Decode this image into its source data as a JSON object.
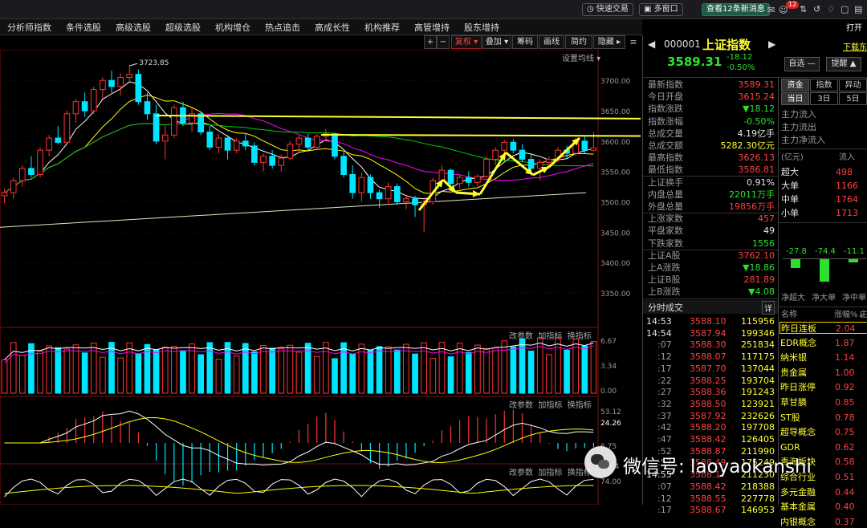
{
  "topbar": {
    "quick_trade": "快速交易",
    "multi_window": "多窗口",
    "news": "查看12条新消息",
    "badge": "12",
    "right_text": "打开"
  },
  "menu": [
    "分析师指数",
    "条件选股",
    "高级选股",
    "超级选股",
    "机构增仓",
    "热点追击",
    "高成长性",
    "机构推荐",
    "高管增持",
    "股东增持"
  ],
  "toolbar": {
    "plus": "+",
    "minus": "−",
    "left": "←",
    "right": "→",
    "restore": "复权",
    "overlay": "叠加",
    "chip": "筹码",
    "draw": "画线",
    "simple": "简约",
    "hide": "隐藏"
  },
  "chart_labels": {
    "ma_settings": "设置均线",
    "high_label": "3723.85",
    "ind_settings": "改参数",
    "ind_add": "加指标",
    "ind_switch": "换指标"
  },
  "price_axis": [
    "3700.00",
    "3650.00",
    "3600.00",
    "3550.00",
    "3500.00",
    "3450.00",
    "3400.00",
    "3350.00"
  ],
  "vol_axis": [
    "6.67",
    "3.34",
    "0.00"
  ],
  "macd_axis": [
    "53.12",
    "24.26",
    "6.75",
    "-21.4"
  ],
  "kdj_axis": [
    "74.00"
  ],
  "colors": {
    "up": "#ff3333",
    "down": "#00e5ff",
    "ma5": "#ffffff",
    "ma10": "#ffff00",
    "ma20": "#ff00ff",
    "ma60": "#00d000",
    "arrow": "#ffff33"
  },
  "chart_data": {
    "type": "candlestick",
    "candles": [
      {
        "o": 3510,
        "h": 3522,
        "l": 3498,
        "c": 3515
      },
      {
        "o": 3515,
        "h": 3540,
        "l": 3505,
        "c": 3535
      },
      {
        "o": 3535,
        "h": 3560,
        "l": 3525,
        "c": 3555
      },
      {
        "o": 3555,
        "h": 3575,
        "l": 3540,
        "c": 3545
      },
      {
        "o": 3545,
        "h": 3590,
        "l": 3540,
        "c": 3585
      },
      {
        "o": 3585,
        "h": 3610,
        "l": 3575,
        "c": 3605
      },
      {
        "o": 3605,
        "h": 3625,
        "l": 3595,
        "c": 3598
      },
      {
        "o": 3598,
        "h": 3650,
        "l": 3595,
        "c": 3645
      },
      {
        "o": 3645,
        "h": 3670,
        "l": 3630,
        "c": 3665
      },
      {
        "o": 3665,
        "h": 3680,
        "l": 3640,
        "c": 3650
      },
      {
        "o": 3650,
        "h": 3690,
        "l": 3645,
        "c": 3685
      },
      {
        "o": 3685,
        "h": 3705,
        "l": 3670,
        "c": 3700
      },
      {
        "o": 3700,
        "h": 3716,
        "l": 3680,
        "c": 3690
      },
      {
        "o": 3690,
        "h": 3712,
        "l": 3675,
        "c": 3705
      },
      {
        "o": 3705,
        "h": 3724,
        "l": 3695,
        "c": 3710
      },
      {
        "o": 3710,
        "h": 3718,
        "l": 3660,
        "c": 3665
      },
      {
        "o": 3665,
        "h": 3680,
        "l": 3635,
        "c": 3645
      },
      {
        "o": 3645,
        "h": 3660,
        "l": 3595,
        "c": 3600
      },
      {
        "o": 3600,
        "h": 3625,
        "l": 3570,
        "c": 3610
      },
      {
        "o": 3610,
        "h": 3660,
        "l": 3605,
        "c": 3655
      },
      {
        "o": 3655,
        "h": 3665,
        "l": 3625,
        "c": 3630
      },
      {
        "o": 3630,
        "h": 3655,
        "l": 3615,
        "c": 3645
      },
      {
        "o": 3645,
        "h": 3648,
        "l": 3610,
        "c": 3615
      },
      {
        "o": 3615,
        "h": 3625,
        "l": 3585,
        "c": 3590
      },
      {
        "o": 3590,
        "h": 3612,
        "l": 3580,
        "c": 3605
      },
      {
        "o": 3605,
        "h": 3610,
        "l": 3570,
        "c": 3585
      },
      {
        "o": 3585,
        "h": 3605,
        "l": 3580,
        "c": 3600
      },
      {
        "o": 3600,
        "h": 3612,
        "l": 3585,
        "c": 3592
      },
      {
        "o": 3592,
        "h": 3598,
        "l": 3560,
        "c": 3565
      },
      {
        "o": 3565,
        "h": 3580,
        "l": 3550,
        "c": 3575
      },
      {
        "o": 3575,
        "h": 3585,
        "l": 3555,
        "c": 3560
      },
      {
        "o": 3560,
        "h": 3578,
        "l": 3550,
        "c": 3572
      },
      {
        "o": 3572,
        "h": 3600,
        "l": 3568,
        "c": 3595
      },
      {
        "o": 3595,
        "h": 3610,
        "l": 3580,
        "c": 3605
      },
      {
        "o": 3605,
        "h": 3612,
        "l": 3585,
        "c": 3590
      },
      {
        "o": 3590,
        "h": 3612,
        "l": 3588,
        "c": 3608
      },
      {
        "o": 3608,
        "h": 3620,
        "l": 3600,
        "c": 3612
      },
      {
        "o": 3612,
        "h": 3614,
        "l": 3570,
        "c": 3575
      },
      {
        "o": 3575,
        "h": 3582,
        "l": 3540,
        "c": 3545
      },
      {
        "o": 3545,
        "h": 3560,
        "l": 3505,
        "c": 3515
      },
      {
        "o": 3515,
        "h": 3548,
        "l": 3500,
        "c": 3540
      },
      {
        "o": 3540,
        "h": 3545,
        "l": 3505,
        "c": 3515
      },
      {
        "o": 3515,
        "h": 3520,
        "l": 3490,
        "c": 3505
      },
      {
        "o": 3505,
        "h": 3532,
        "l": 3495,
        "c": 3525
      },
      {
        "o": 3525,
        "h": 3530,
        "l": 3495,
        "c": 3500
      },
      {
        "o": 3500,
        "h": 3512,
        "l": 3488,
        "c": 3505
      },
      {
        "o": 3505,
        "h": 3510,
        "l": 3475,
        "c": 3495
      },
      {
        "o": 3495,
        "h": 3505,
        "l": 3450,
        "c": 3500
      },
      {
        "o": 3500,
        "h": 3540,
        "l": 3495,
        "c": 3535
      },
      {
        "o": 3535,
        "h": 3560,
        "l": 3530,
        "c": 3552
      },
      {
        "o": 3552,
        "h": 3555,
        "l": 3525,
        "c": 3530
      },
      {
        "o": 3530,
        "h": 3545,
        "l": 3522,
        "c": 3540
      },
      {
        "o": 3540,
        "h": 3550,
        "l": 3525,
        "c": 3532
      },
      {
        "o": 3532,
        "h": 3545,
        "l": 3525,
        "c": 3542
      },
      {
        "o": 3542,
        "h": 3575,
        "l": 3538,
        "c": 3570
      },
      {
        "o": 3570,
        "h": 3590,
        "l": 3560,
        "c": 3585
      },
      {
        "o": 3585,
        "h": 3602,
        "l": 3578,
        "c": 3598
      },
      {
        "o": 3598,
        "h": 3603,
        "l": 3580,
        "c": 3585
      },
      {
        "o": 3585,
        "h": 3595,
        "l": 3565,
        "c": 3570
      },
      {
        "o": 3570,
        "h": 3580,
        "l": 3548,
        "c": 3555
      },
      {
        "o": 3555,
        "h": 3570,
        "l": 3535,
        "c": 3565
      },
      {
        "o": 3565,
        "h": 3575,
        "l": 3555,
        "c": 3570
      },
      {
        "o": 3570,
        "h": 3590,
        "l": 3565,
        "c": 3585
      },
      {
        "o": 3585,
        "h": 3592,
        "l": 3570,
        "c": 3580
      },
      {
        "o": 3580,
        "h": 3605,
        "l": 3575,
        "c": 3600
      },
      {
        "o": 3600,
        "h": 3608,
        "l": 3580,
        "c": 3585
      },
      {
        "o": 3585,
        "h": 3615,
        "l": 3583,
        "c": 3589
      }
    ],
    "y_range": [
      3330,
      3740
    ]
  },
  "quote": {
    "code": "000001",
    "name": "上证指数",
    "price": "3589.31",
    "change": "-18.12",
    "pct": "-0.50%",
    "self_select": "自选 —",
    "alert": "提醒 ▲",
    "download": "下载东"
  },
  "quote_rows": [
    {
      "l": "最新指数",
      "v": "3589.31",
      "c": "red"
    },
    {
      "l": "今日开盘",
      "v": "3615.24",
      "c": "red"
    },
    {
      "l": "指数涨跌",
      "v": "▼18.12",
      "c": "green"
    },
    {
      "l": "指数涨幅",
      "v": "-0.50%",
      "c": "green"
    },
    {
      "l": "总成交量",
      "v": "4.19亿手",
      "c": "white"
    },
    {
      "l": "总成交额",
      "v": "5282.30亿元",
      "c": "yellow"
    },
    {
      "l": "最高指数",
      "v": "3626.13",
      "c": "red"
    },
    {
      "l": "最低指数",
      "v": "3586.81",
      "c": "red"
    },
    {
      "l": "上证换手",
      "v": "0.91%",
      "c": "white"
    },
    {
      "l": "内盘总量",
      "v": "22011万手",
      "c": "green"
    },
    {
      "l": "外盘总量",
      "v": "19856万手",
      "c": "red"
    },
    {
      "l": "上涨家数",
      "v": "457",
      "c": "red"
    },
    {
      "l": "平盘家数",
      "v": "49",
      "c": "white"
    },
    {
      "l": "下跌家数",
      "v": "1556",
      "c": "green"
    },
    {
      "l": "上证A股",
      "v": "3762.10",
      "c": "red"
    },
    {
      "l": "上A涨跌",
      "v": "▼18.86",
      "c": "green"
    },
    {
      "l": "上证B股",
      "v": "281.89",
      "c": "red"
    },
    {
      "l": "上B涨跌",
      "v": "▼4.08",
      "c": "green"
    }
  ],
  "time_sales": {
    "title": "分时成交",
    "detail": "详",
    "rows": [
      {
        "t": "14:53",
        "p": "3588.10",
        "v": "115956"
      },
      {
        "t": "14:54",
        "p": "3587.94",
        "v": "199346"
      },
      {
        "t": ":07",
        "p": "3588.30",
        "v": "251834"
      },
      {
        "t": ":12",
        "p": "3588.07",
        "v": "117175"
      },
      {
        "t": ":17",
        "p": "3587.70",
        "v": "137044"
      },
      {
        "t": ":22",
        "p": "3588.25",
        "v": "193704"
      },
      {
        "t": ":27",
        "p": "3588.36",
        "v": "191243"
      },
      {
        "t": ":32",
        "p": "3588.50",
        "v": "123921"
      },
      {
        "t": ":37",
        "p": "3587.92",
        "v": "232626"
      },
      {
        "t": ":42",
        "p": "3588.20",
        "v": "197708"
      },
      {
        "t": ":47",
        "p": "3588.42",
        "v": "126405"
      },
      {
        "t": ":52",
        "p": "3588.87",
        "v": "211990"
      },
      {
        "t": ":57",
        "p": "3588.49",
        "v": "175249"
      },
      {
        "t": "14:55",
        "p": "3588.17",
        "v": "211230"
      },
      {
        "t": ":07",
        "p": "3588.42",
        "v": "218388"
      },
      {
        "t": ":12",
        "p": "3588.55",
        "v": "227778"
      },
      {
        "t": ":17",
        "p": "3588.67",
        "v": "146953"
      }
    ]
  },
  "fund": {
    "tabs": [
      "资金",
      "指数",
      "异动"
    ],
    "period": [
      "当日",
      "3日",
      "5日"
    ],
    "rows": [
      "主力流入",
      "主力流出",
      "主力净流入"
    ],
    "unit": "(亿元)",
    "inflow": "流入",
    "sizes": [
      {
        "l": "超大",
        "v": "498"
      },
      {
        "l": "大单",
        "v": "1166"
      },
      {
        "l": "中单",
        "v": "1764"
      },
      {
        "l": "小单",
        "v": "1713"
      }
    ],
    "net_values": [
      "-27.8",
      "-74.4",
      "-11.1"
    ],
    "net_labels": [
      "净超大",
      "净大单",
      "净中单"
    ]
  },
  "sectors": {
    "col_name": "名称",
    "col_pct": "涨幅%↓",
    "col_extra": "主",
    "rows": [
      {
        "n": "昨日连板",
        "v": "2.04"
      },
      {
        "n": "EDR概念",
        "v": "1.87"
      },
      {
        "n": "纳米银",
        "v": "1.14"
      },
      {
        "n": "贵金属",
        "v": "1.00"
      },
      {
        "n": "昨日涨停",
        "v": "0.92"
      },
      {
        "n": "草甘膦",
        "v": "0.85"
      },
      {
        "n": "ST股",
        "v": "0.78"
      },
      {
        "n": "超导概念",
        "v": "0.75"
      },
      {
        "n": "GDR",
        "v": "0.62"
      },
      {
        "n": "青海板块",
        "v": "0.58"
      },
      {
        "n": "综合行业",
        "v": "0.51"
      },
      {
        "n": "多元金融",
        "v": "0.44"
      },
      {
        "n": "基本金属",
        "v": "0.40"
      },
      {
        "n": "内银概念",
        "v": "0.37"
      }
    ]
  },
  "watermark": "微信号: laoyaokanshi"
}
